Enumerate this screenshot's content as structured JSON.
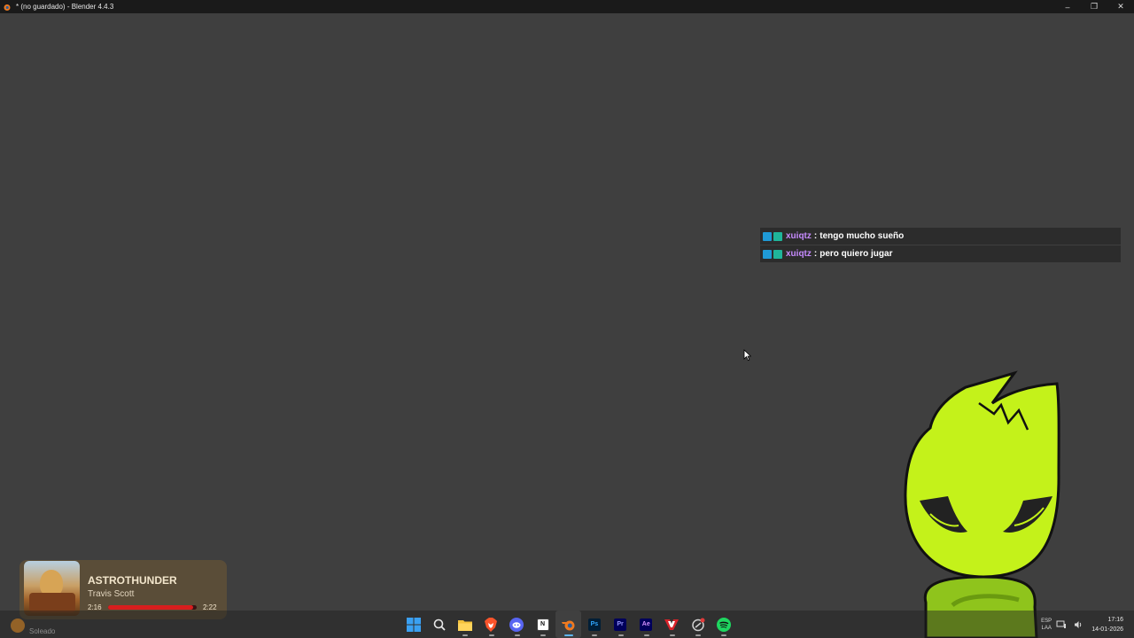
{
  "window": {
    "title": "* (no guardado) - Blender 4.4.3",
    "controls": {
      "minimize": "–",
      "restore": "❐",
      "close": "✕"
    }
  },
  "chat": {
    "messages": [
      {
        "user": "xuiqtz",
        "separator": ":",
        "text": "tengo mucho sueño"
      },
      {
        "user": "xuiqtz",
        "separator": ":",
        "text": "pero quiero jugar"
      }
    ]
  },
  "player": {
    "track": "ASTROTHUNDER",
    "artist": "Travis Scott",
    "elapsed": "2:16",
    "total": "2:22",
    "progress": 0.96,
    "accent": "#d81e1e"
  },
  "weather": {
    "icon": "sun-icon",
    "condition": "Soleado"
  },
  "taskbar": {
    "apps": [
      {
        "name": "start-icon"
      },
      {
        "name": "search-icon"
      },
      {
        "name": "file-explorer-icon"
      },
      {
        "name": "brave-browser-icon"
      },
      {
        "name": "discord-icon"
      },
      {
        "name": "notion-icon",
        "label": "N"
      },
      {
        "name": "blender-icon",
        "active": true
      },
      {
        "name": "photoshop-icon",
        "label": "Ps"
      },
      {
        "name": "premiere-icon",
        "label": "Pr"
      },
      {
        "name": "after-effects-icon",
        "label": "Ae"
      },
      {
        "name": "app-v-icon"
      },
      {
        "name": "app-circle-icon"
      },
      {
        "name": "spotify-icon"
      }
    ],
    "tray": {
      "lang_top": "ESP",
      "lang_bottom": "LAA",
      "time": "17:16",
      "date": "14-01-2026"
    }
  }
}
